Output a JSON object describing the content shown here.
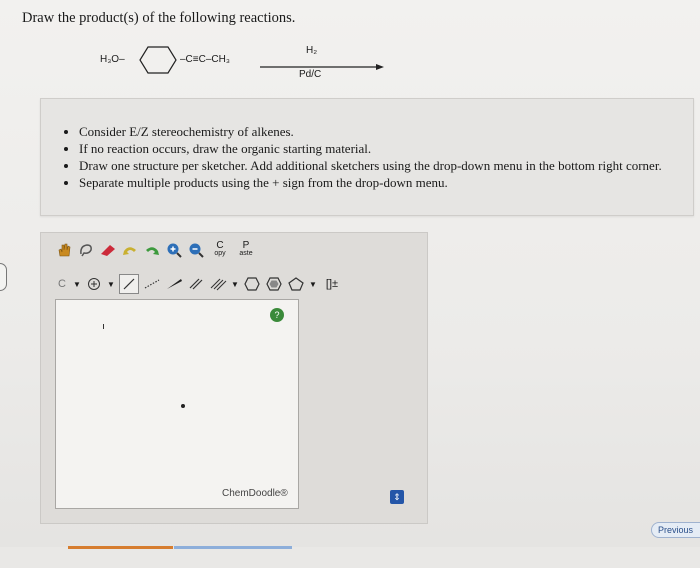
{
  "question": "Draw the product(s) of the following reactions.",
  "reaction": {
    "reactant_left": "H₃O–",
    "reactant_right": "–C≡C–CH₃",
    "reagent_top": "H₂",
    "reagent_bottom": "Pd/C"
  },
  "instructions": [
    "Consider E/Z stereochemistry of alkenes.",
    "If no reaction occurs, draw the organic starting material.",
    "Draw one structure per sketcher. Add additional sketchers using the drop-down menu in the bottom right corner.",
    "Separate multiple products using the + sign from the drop-down menu."
  ],
  "toolbar": {
    "copy_top": "C",
    "copy_bottom": "opy",
    "paste_top": "P",
    "paste_bottom": "aste",
    "carbon_label": "C",
    "bracket_label": "[]±"
  },
  "canvas": {
    "watermark": "ChemDoodle®",
    "help_label": "?"
  },
  "footer": {
    "previous_label": "Previous"
  },
  "colors": {
    "accent_blue": "#2456a8",
    "progress_orange": "#d67d2f",
    "help_green": "#3a8a3a"
  }
}
